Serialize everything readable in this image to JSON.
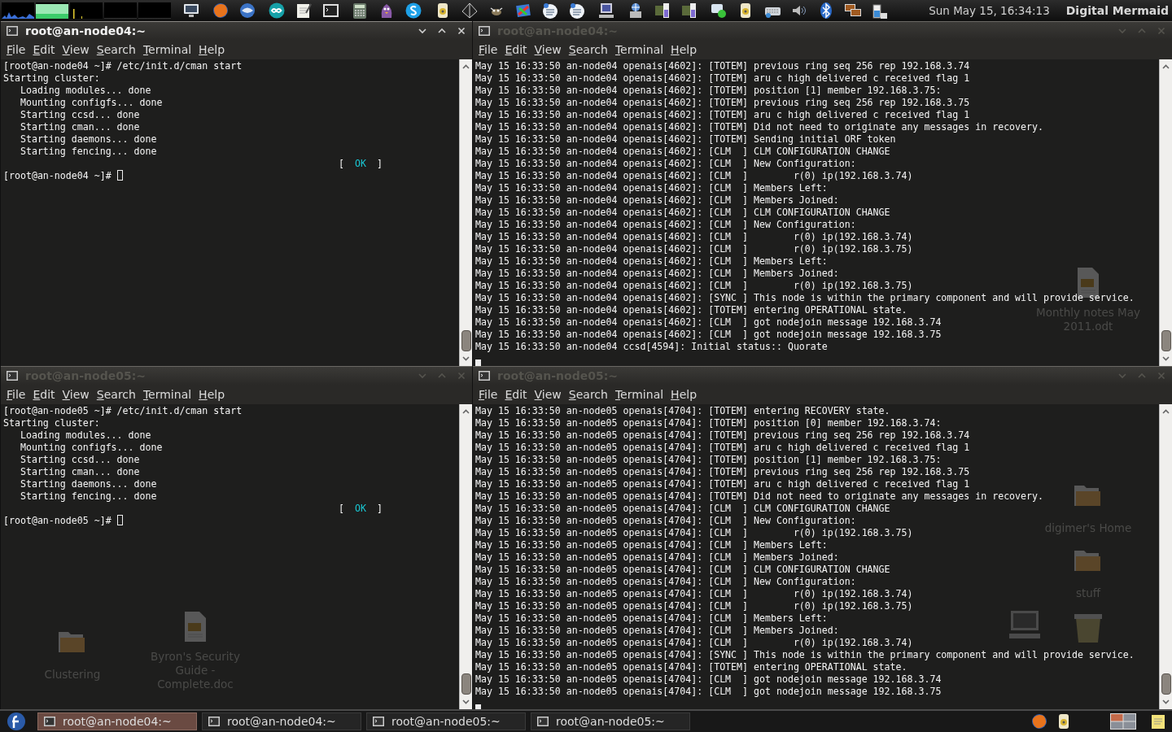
{
  "top_panel": {
    "clock": "Sun May 15, 16:34:13",
    "user": "Digital Mermaid"
  },
  "terminals": [
    {
      "title": "root@an-node04:~",
      "active": true,
      "menu": [
        "File",
        "Edit",
        "View",
        "Search",
        "Terminal",
        "Help"
      ],
      "lines": [
        {
          "kind": "prompt",
          "text": "[root@an-node04 ~]# /etc/init.d/cman start",
          "cursor": false
        },
        {
          "kind": "text",
          "text": "Starting cluster: "
        },
        {
          "kind": "text",
          "text": "   Loading modules... done"
        },
        {
          "kind": "text",
          "text": "   Mounting configfs... done"
        },
        {
          "kind": "text",
          "text": "   Starting ccsd... done"
        },
        {
          "kind": "text",
          "text": "   Starting cman... done"
        },
        {
          "kind": "text",
          "text": "   Starting daemons... done"
        },
        {
          "kind": "text",
          "text": "   Starting fencing... done"
        },
        {
          "kind": "status",
          "parts": [
            "[",
            "OK",
            "]"
          ]
        },
        {
          "kind": "prompt",
          "text": "[root@an-node04 ~]# ",
          "cursor": true
        }
      ]
    },
    {
      "title": "root@an-node04:~",
      "active": false,
      "menu": [
        "File",
        "Edit",
        "View",
        "Search",
        "Terminal",
        "Help"
      ],
      "lines": [
        {
          "kind": "text",
          "text": "May 15 16:33:50 an-node04 openais[4602]: [TOTEM] previous ring seq 256 rep 192.168.3.74"
        },
        {
          "kind": "text",
          "text": "May 15 16:33:50 an-node04 openais[4602]: [TOTEM] aru c high delivered c received flag 1"
        },
        {
          "kind": "text",
          "text": "May 15 16:33:50 an-node04 openais[4602]: [TOTEM] position [1] member 192.168.3.75:"
        },
        {
          "kind": "text",
          "text": "May 15 16:33:50 an-node04 openais[4602]: [TOTEM] previous ring seq 256 rep 192.168.3.75"
        },
        {
          "kind": "text",
          "text": "May 15 16:33:50 an-node04 openais[4602]: [TOTEM] aru c high delivered c received flag 1"
        },
        {
          "kind": "text",
          "text": "May 15 16:33:50 an-node04 openais[4602]: [TOTEM] Did not need to originate any messages in recovery."
        },
        {
          "kind": "text",
          "text": "May 15 16:33:50 an-node04 openais[4602]: [TOTEM] Sending initial ORF token"
        },
        {
          "kind": "text",
          "text": "May 15 16:33:50 an-node04 openais[4602]: [CLM  ] CLM CONFIGURATION CHANGE"
        },
        {
          "kind": "text",
          "text": "May 15 16:33:50 an-node04 openais[4602]: [CLM  ] New Configuration:"
        },
        {
          "kind": "text",
          "text": "May 15 16:33:50 an-node04 openais[4602]: [CLM  ]        r(0) ip(192.168.3.74)"
        },
        {
          "kind": "text",
          "text": "May 15 16:33:50 an-node04 openais[4602]: [CLM  ] Members Left:"
        },
        {
          "kind": "text",
          "text": "May 15 16:33:50 an-node04 openais[4602]: [CLM  ] Members Joined:"
        },
        {
          "kind": "text",
          "text": "May 15 16:33:50 an-node04 openais[4602]: [CLM  ] CLM CONFIGURATION CHANGE"
        },
        {
          "kind": "text",
          "text": "May 15 16:33:50 an-node04 openais[4602]: [CLM  ] New Configuration:"
        },
        {
          "kind": "text",
          "text": "May 15 16:33:50 an-node04 openais[4602]: [CLM  ]        r(0) ip(192.168.3.74)"
        },
        {
          "kind": "text",
          "text": "May 15 16:33:50 an-node04 openais[4602]: [CLM  ]        r(0) ip(192.168.3.75)"
        },
        {
          "kind": "text",
          "text": "May 15 16:33:50 an-node04 openais[4602]: [CLM  ] Members Left:"
        },
        {
          "kind": "text",
          "text": "May 15 16:33:50 an-node04 openais[4602]: [CLM  ] Members Joined:"
        },
        {
          "kind": "text",
          "text": "May 15 16:33:50 an-node04 openais[4602]: [CLM  ]        r(0) ip(192.168.3.75)"
        },
        {
          "kind": "text",
          "text": "May 15 16:33:50 an-node04 openais[4602]: [SYNC ] This node is within the primary component and will provide service."
        },
        {
          "kind": "text",
          "text": "May 15 16:33:50 an-node04 openais[4602]: [TOTEM] entering OPERATIONAL state."
        },
        {
          "kind": "text",
          "text": "May 15 16:33:50 an-node04 openais[4602]: [CLM  ] got nodejoin message 192.168.3.74"
        },
        {
          "kind": "text",
          "text": "May 15 16:33:50 an-node04 openais[4602]: [CLM  ] got nodejoin message 192.168.3.75"
        },
        {
          "kind": "text",
          "text": "May 15 16:33:50 an-node04 ccsd[4594]: Initial status:: Quorate"
        },
        {
          "kind": "cursor"
        }
      ],
      "desktop_items": [
        {
          "kind": "document",
          "label": "Monthly notes May 2011.odt"
        }
      ]
    },
    {
      "title": "root@an-node05:~",
      "active": false,
      "menu": [
        "File",
        "Edit",
        "View",
        "Search",
        "Terminal",
        "Help"
      ],
      "lines": [
        {
          "kind": "prompt",
          "text": "[root@an-node05 ~]# /etc/init.d/cman start",
          "cursor": false
        },
        {
          "kind": "text",
          "text": "Starting cluster: "
        },
        {
          "kind": "text",
          "text": "   Loading modules... done"
        },
        {
          "kind": "text",
          "text": "   Mounting configfs... done"
        },
        {
          "kind": "text",
          "text": "   Starting ccsd... done"
        },
        {
          "kind": "text",
          "text": "   Starting cman... done"
        },
        {
          "kind": "text",
          "text": "   Starting daemons... done"
        },
        {
          "kind": "text",
          "text": "   Starting fencing... done"
        },
        {
          "kind": "status",
          "parts": [
            "[",
            "OK",
            "]"
          ]
        },
        {
          "kind": "prompt",
          "text": "[root@an-node05 ~]# ",
          "cursor": true
        }
      ],
      "desktop_items": [
        {
          "kind": "folder",
          "label": "Clustering"
        },
        {
          "kind": "document",
          "label": "Byron's Security Guide - Complete.doc"
        }
      ]
    },
    {
      "title": "root@an-node05:~",
      "active": false,
      "menu": [
        "File",
        "Edit",
        "View",
        "Search",
        "Terminal",
        "Help"
      ],
      "lines": [
        {
          "kind": "text",
          "text": "May 15 16:33:50 an-node05 openais[4704]: [TOTEM] entering RECOVERY state."
        },
        {
          "kind": "text",
          "text": "May 15 16:33:50 an-node05 openais[4704]: [TOTEM] position [0] member 192.168.3.74:"
        },
        {
          "kind": "text",
          "text": "May 15 16:33:50 an-node05 openais[4704]: [TOTEM] previous ring seq 256 rep 192.168.3.74"
        },
        {
          "kind": "text",
          "text": "May 15 16:33:50 an-node05 openais[4704]: [TOTEM] aru c high delivered c received flag 1"
        },
        {
          "kind": "text",
          "text": "May 15 16:33:50 an-node05 openais[4704]: [TOTEM] position [1] member 192.168.3.75:"
        },
        {
          "kind": "text",
          "text": "May 15 16:33:50 an-node05 openais[4704]: [TOTEM] previous ring seq 256 rep 192.168.3.75"
        },
        {
          "kind": "text",
          "text": "May 15 16:33:50 an-node05 openais[4704]: [TOTEM] aru c high delivered c received flag 1"
        },
        {
          "kind": "text",
          "text": "May 15 16:33:50 an-node05 openais[4704]: [TOTEM] Did not need to originate any messages in recovery."
        },
        {
          "kind": "text",
          "text": "May 15 16:33:50 an-node05 openais[4704]: [CLM  ] CLM CONFIGURATION CHANGE"
        },
        {
          "kind": "text",
          "text": "May 15 16:33:50 an-node05 openais[4704]: [CLM  ] New Configuration:"
        },
        {
          "kind": "text",
          "text": "May 15 16:33:50 an-node05 openais[4704]: [CLM  ]        r(0) ip(192.168.3.75)"
        },
        {
          "kind": "text",
          "text": "May 15 16:33:50 an-node05 openais[4704]: [CLM  ] Members Left:"
        },
        {
          "kind": "text",
          "text": "May 15 16:33:50 an-node05 openais[4704]: [CLM  ] Members Joined:"
        },
        {
          "kind": "text",
          "text": "May 15 16:33:50 an-node05 openais[4704]: [CLM  ] CLM CONFIGURATION CHANGE"
        },
        {
          "kind": "text",
          "text": "May 15 16:33:50 an-node05 openais[4704]: [CLM  ] New Configuration:"
        },
        {
          "kind": "text",
          "text": "May 15 16:33:50 an-node05 openais[4704]: [CLM  ]        r(0) ip(192.168.3.74)"
        },
        {
          "kind": "text",
          "text": "May 15 16:33:50 an-node05 openais[4704]: [CLM  ]        r(0) ip(192.168.3.75)"
        },
        {
          "kind": "text",
          "text": "May 15 16:33:50 an-node05 openais[4704]: [CLM  ] Members Left:"
        },
        {
          "kind": "text",
          "text": "May 15 16:33:50 an-node05 openais[4704]: [CLM  ] Members Joined:"
        },
        {
          "kind": "text",
          "text": "May 15 16:33:50 an-node05 openais[4704]: [CLM  ]        r(0) ip(192.168.3.74)"
        },
        {
          "kind": "text",
          "text": "May 15 16:33:50 an-node05 openais[4704]: [SYNC ] This node is within the primary component and will provide service."
        },
        {
          "kind": "text",
          "text": "May 15 16:33:50 an-node05 openais[4704]: [TOTEM] entering OPERATIONAL state."
        },
        {
          "kind": "text",
          "text": "May 15 16:33:50 an-node05 openais[4704]: [CLM  ] got nodejoin message 192.168.3.74"
        },
        {
          "kind": "text",
          "text": "May 15 16:33:50 an-node05 openais[4704]: [CLM  ] got nodejoin message 192.168.3.75"
        },
        {
          "kind": "cursor"
        }
      ],
      "desktop_items": [
        {
          "kind": "folder",
          "label": "digimer's Home"
        },
        {
          "kind": "folder",
          "label": "stuff"
        },
        {
          "kind": "computer"
        },
        {
          "kind": "trash"
        }
      ]
    }
  ],
  "taskbar": {
    "tasks": [
      {
        "label": "root@an-node04:~",
        "selected": true
      },
      {
        "label": "root@an-node04:~",
        "selected": false
      },
      {
        "label": "root@an-node05:~",
        "selected": false
      },
      {
        "label": "root@an-node05:~",
        "selected": false
      }
    ]
  }
}
